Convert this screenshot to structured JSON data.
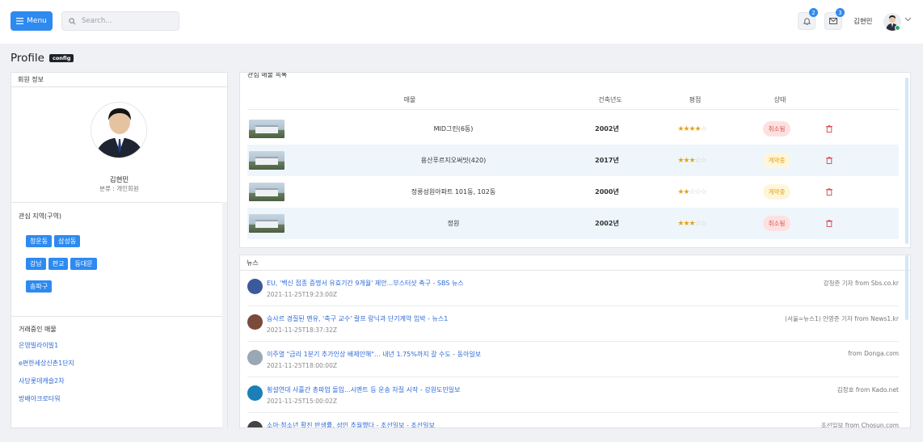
{
  "header": {
    "menu_label": "Menu",
    "search_placeholder": "Search...",
    "notifications_count": "2",
    "messages_count": "3",
    "user_name": "김현민"
  },
  "page": {
    "title": "Profile",
    "config_badge": "config"
  },
  "member": {
    "panel_title": "회원 정보",
    "name": "김현민",
    "category": "분류 : 개인회원"
  },
  "regions": {
    "title": "관심 지역(구역)",
    "tags": [
      "청운동",
      "삼성동",
      "강남",
      "판교",
      "동대문",
      "송파구"
    ]
  },
  "trading": {
    "title": "거래중인 매물",
    "items": [
      "은영빌라이빌1",
      "e편한세상신촌1단지",
      "사당롯데캐슬2차",
      "방배아크로타워"
    ]
  },
  "properties": {
    "title": "관심 매물 목록",
    "columns": [
      "매물",
      "건축년도",
      "평점",
      "상태"
    ],
    "rows": [
      {
        "name": "MID그린(6동)",
        "year": "2002년",
        "rating": 4.5,
        "status": "취소됨",
        "status_type": "cancel"
      },
      {
        "name": "용산푸르지오써밋(420)",
        "year": "2017년",
        "rating": 3.5,
        "status": "계약중",
        "status_type": "contract"
      },
      {
        "name": "정릉성원아파트 101동, 102동",
        "year": "2000년",
        "rating": 2.5,
        "status": "계약중",
        "status_type": "contract"
      },
      {
        "name": "정원",
        "year": "2002년",
        "rating": 3.5,
        "status": "취소됨",
        "status_type": "cancel"
      }
    ]
  },
  "news": {
    "title": "뉴스",
    "items": [
      {
        "title": "EU, '백신 접종 증명서 유효기간 9개월' 제안...부스터샷 촉구 - SBS 뉴스",
        "date": "2021-11-25T19:23:00Z",
        "source": "강청준 기자 from Sbs.co.kr",
        "icon_color": "#3b5a99"
      },
      {
        "title": "승사르 경질된 맨유, '축구 교수' 랄프 랑닉과 단기계약 임박 - 뉴스1",
        "date": "2021-11-25T18:37:32Z",
        "source": "(서울=뉴스1) 안영준 기자 from News1.kr",
        "icon_color": "#7a4a3a"
      },
      {
        "title": "이주열 \"금리 1분기 추가인상 배제안해\"... 내년 1.75%까지 갈 수도 - 동아일보",
        "date": "2021-11-25T18:00:00Z",
        "source": "from Donga.com",
        "icon_color": "#9aa7b5"
      },
      {
        "title": "횡설연대 사흘간 총파업 돌입...시멘트 등 운송 차질 시작 - 강원도민일보",
        "date": "2021-11-25T15:00:02Z",
        "source": "김정호 from Kado.net",
        "icon_color": "#1b7fb8"
      },
      {
        "title": "소아·청소년 확진 반생률, 성인 추월했다 - 조선일보 - 조선일보",
        "date": "",
        "source": "조선일보 from Chosun.com",
        "icon_color": "#444"
      }
    ]
  },
  "colors": {
    "accent": "#2e8af0",
    "link": "#2e6ad8",
    "scrollbar": "#cfe9f7"
  }
}
